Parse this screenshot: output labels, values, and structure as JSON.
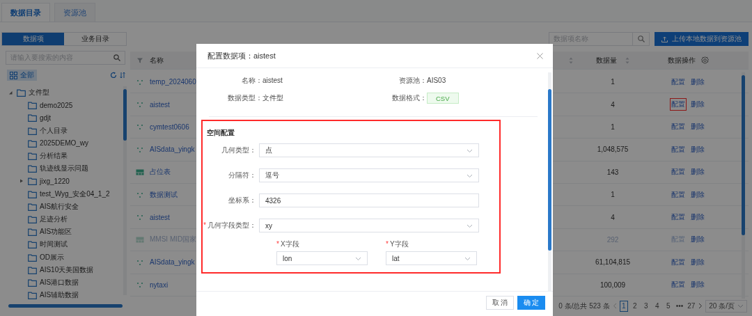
{
  "top_tabs": [
    {
      "label": "数据目录",
      "selected": true
    },
    {
      "label": "资源池",
      "selected": false
    }
  ],
  "sidebar": {
    "segments": [
      {
        "label": "数据项",
        "selected": true
      },
      {
        "label": "业务目录",
        "selected": false
      }
    ],
    "search": {
      "placeholder": "请输入要搜索的内容"
    },
    "all_button": "全部",
    "tree": [
      {
        "label": "文件型",
        "expanded": true,
        "children": [
          {
            "label": "demo2025",
            "expandable": false
          },
          {
            "label": "gdjt",
            "expandable": false
          },
          {
            "label": "个人目录",
            "expandable": false
          },
          {
            "label": "2025DEMO_wy",
            "expandable": false
          },
          {
            "label": "分析结果",
            "expandable": false
          },
          {
            "label": "轨迹线显示问题",
            "expandable": false
          },
          {
            "label": "jixg_1220",
            "expandable": true
          },
          {
            "label": "test_Wyg_安全04_1_2",
            "expandable": false
          },
          {
            "label": "AIS航行安全",
            "expandable": false
          },
          {
            "label": "足迹分析",
            "expandable": false
          },
          {
            "label": "AIS功能区",
            "expandable": false
          },
          {
            "label": "时间测试",
            "expandable": false
          },
          {
            "label": "OD展示",
            "expandable": false
          },
          {
            "label": "AIS10天美国数据",
            "expandable": false
          },
          {
            "label": "AIS港口数据",
            "expandable": false
          },
          {
            "label": "AIS辅助数据",
            "expandable": false
          }
        ]
      }
    ]
  },
  "toolbar": {
    "search": {
      "placeholder": "数据项名称"
    },
    "upload_button": "上传本地数据到资源池"
  },
  "table": {
    "name_header": "名称",
    "count_header": "数据量",
    "actions_header": "数据操作",
    "rows": [
      {
        "kind": "point",
        "name": "temp_2024060",
        "count": "1",
        "actions": [
          "配置",
          "删除"
        ],
        "disabled": false,
        "highlighted": false
      },
      {
        "kind": "point",
        "name": "aistest",
        "count": "4",
        "actions": [
          "配置",
          "删除"
        ],
        "disabled": false,
        "highlighted": true
      },
      {
        "kind": "point",
        "name": "cymtest0606",
        "count": "1",
        "actions": [
          "配置",
          "删除"
        ],
        "disabled": false,
        "highlighted": false
      },
      {
        "kind": "point",
        "name": "AISdata_yingk",
        "count": "1,048,575",
        "actions": [
          "配置",
          "删除"
        ],
        "disabled": false,
        "highlighted": false
      },
      {
        "kind": "table",
        "name": "占位表",
        "count": "143",
        "actions": [
          "配置",
          "删除"
        ],
        "disabled": false,
        "highlighted": false
      },
      {
        "kind": "point",
        "name": "数据测试",
        "count": "1",
        "actions": [
          "配置",
          "删除"
        ],
        "disabled": false,
        "highlighted": false
      },
      {
        "kind": "point",
        "name": "aistest",
        "count": "4",
        "actions": [
          "配置",
          "删除"
        ],
        "disabled": false,
        "highlighted": false
      },
      {
        "kind": "table",
        "name": "MMSI MID国家",
        "count": "292",
        "actions": [
          "配置",
          "删除"
        ],
        "disabled": true,
        "highlighted": false
      },
      {
        "kind": "point",
        "name": "AISdata_yingk",
        "count": "61,104,815",
        "actions": [
          "配置",
          "删除"
        ],
        "disabled": false,
        "highlighted": false
      },
      {
        "kind": "point",
        "name": "nytaxi",
        "count": "100,009",
        "actions": [
          "配置",
          "删除"
        ],
        "disabled": false,
        "highlighted": false
      }
    ]
  },
  "pagination": {
    "summary": "0 条/总共 523 条",
    "pages": [
      {
        "label": "1",
        "selected": true
      },
      {
        "label": "2",
        "selected": false
      },
      {
        "label": "3",
        "selected": false
      },
      {
        "label": "4",
        "selected": false
      },
      {
        "label": "5",
        "selected": false
      },
      {
        "label": "•••",
        "selected": false
      },
      {
        "label": "27",
        "selected": false
      }
    ],
    "page_size": "20 条/页"
  },
  "modal": {
    "title": "配置数据项：aistest",
    "info": [
      {
        "label": "名称：",
        "value": "aistest",
        "kind": "text"
      },
      {
        "label": "资源池：",
        "value": "AIS03",
        "kind": "text"
      },
      {
        "label": "数据类型：",
        "value": "文件型",
        "kind": "text"
      },
      {
        "label": "数据格式：",
        "value": "CSV",
        "kind": "tag"
      }
    ],
    "section": {
      "title": "空间配置",
      "highlighted": true,
      "fields": [
        {
          "label": "几何类型：",
          "value": "点",
          "kind": "select"
        },
        {
          "label": "分隔符：",
          "value": "逗号",
          "kind": "select"
        },
        {
          "label": "坐标系：",
          "value": "4326",
          "kind": "input"
        },
        {
          "mark": "*",
          "label": "几何字段类型：",
          "value": "xy",
          "kind": "select"
        }
      ],
      "subfields": [
        {
          "mark": "*",
          "label": "X字段",
          "value": "lon"
        },
        {
          "mark": "*",
          "label": "Y字段",
          "value": "lat"
        }
      ]
    },
    "buttons": [
      {
        "label": "取 消",
        "kind": "default"
      },
      {
        "label": "确 定",
        "kind": "primary"
      }
    ]
  }
}
